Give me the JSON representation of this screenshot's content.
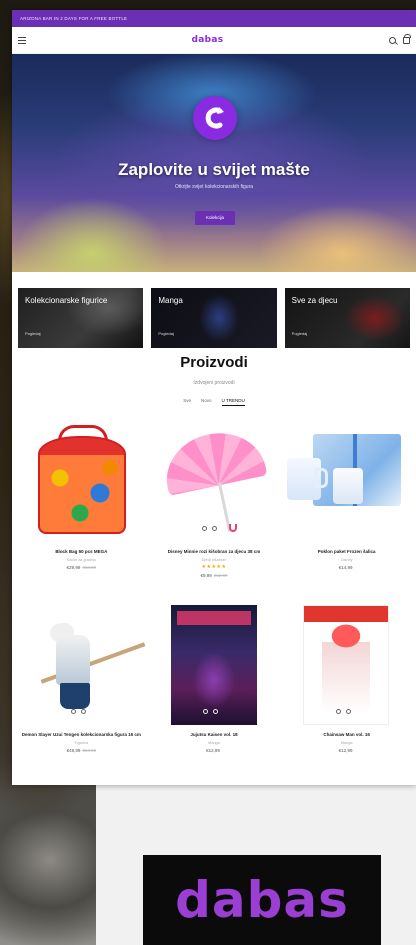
{
  "announcement": "ARIZONA BAR IN 2 DAYS FOR A FREE BOTTLE",
  "header": {
    "logo": "dabas",
    "menu_icon": "hamburger-menu-icon",
    "search_icon": "search-icon",
    "cart_icon": "cart-icon"
  },
  "hero": {
    "logo_icon": "dabas-c-logo",
    "title": "Zaplovite u svijet mašte",
    "subtitle": "Otkrijte svijet kolekcionarskih figura",
    "button": "Kolekcija"
  },
  "categories": [
    {
      "title": "Kolekcionarske figurice",
      "link": "Pogledaj"
    },
    {
      "title": "Manga",
      "link": "Pogledaj"
    },
    {
      "title": "Sve za djecu",
      "link": "Pogledaj"
    }
  ],
  "products_section": {
    "title": "Proizvodi",
    "subtitle": "Izdvojeni proizvodi",
    "tabs": [
      "Sve",
      "Novo",
      "U TRENDU"
    ],
    "active_tab": 2
  },
  "products": [
    {
      "name": "Block Bag 50 pcs MEGA",
      "meta": "Kocke za gradnju",
      "stars": "",
      "price": "€29,99",
      "old_price": "€34,99"
    },
    {
      "name": "Disney Minnie rozi kišobran za djecu 38 cm",
      "meta": "Dječji kišobran",
      "stars": "★★★★★",
      "price": "€9,99",
      "old_price": "€12,99"
    },
    {
      "name": "Poklon paket Frozen šalica",
      "meta": "Disney",
      "stars": "",
      "price": "€14,99",
      "old_price": ""
    },
    {
      "name": "Demon Slayer Uzui Tengen kolekcionarska figura 16 cm",
      "meta": "Figurica",
      "stars": "",
      "price": "€49,99",
      "old_price": "€54,99"
    },
    {
      "name": "Jujutsu Kaisen vol. 18",
      "meta": "Manga",
      "stars": "",
      "price": "€12,99",
      "old_price": ""
    },
    {
      "name": "Chainsaw Man vol. 16",
      "meta": "Manga",
      "stars": "",
      "price": "€12,99",
      "old_price": ""
    }
  ],
  "brand_card": {
    "logo_text": "dabas"
  },
  "colors": {
    "brand_purple": "#8a2be2",
    "announcement_bg": "#6b2fb3",
    "star_color": "#f0a400"
  }
}
